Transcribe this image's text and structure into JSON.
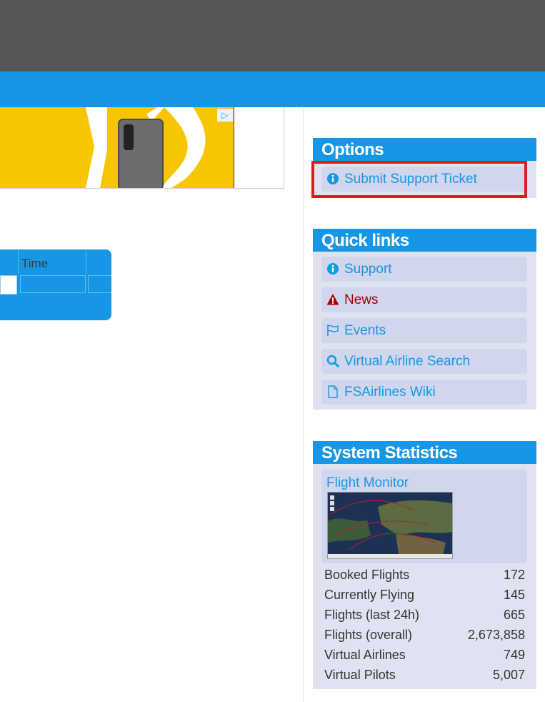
{
  "table": {
    "time_header": "Time"
  },
  "options": {
    "title": "Options",
    "items": [
      {
        "label": "Submit Support Ticket",
        "icon": "info-icon"
      }
    ]
  },
  "quick_links": {
    "title": "Quick links",
    "items": [
      {
        "label": "Support",
        "icon": "info-icon"
      },
      {
        "label": "News",
        "icon": "warning-icon"
      },
      {
        "label": "Events",
        "icon": "flag-icon"
      },
      {
        "label": "Virtual Airline Search",
        "icon": "search-icon"
      },
      {
        "label": "FSAirlines Wiki",
        "icon": "document-icon"
      }
    ]
  },
  "system_statistics": {
    "title": "System Statistics",
    "flight_monitor": "Flight Monitor",
    "rows": [
      {
        "label": "Booked Flights",
        "value": "172"
      },
      {
        "label": "Currently Flying",
        "value": "145"
      },
      {
        "label": "Flights (last 24h)",
        "value": "665"
      },
      {
        "label": "Flights (overall)",
        "value": "2,673,858"
      },
      {
        "label": "Virtual Airlines",
        "value": "749"
      },
      {
        "label": "Virtual Pilots",
        "value": "5,007"
      }
    ]
  },
  "colors": {
    "accent": "#1597e5",
    "panel_bg": "#dfe3f1",
    "item_bg": "#d0d6ec",
    "highlight": "#e4191f",
    "news": "#a80000"
  }
}
